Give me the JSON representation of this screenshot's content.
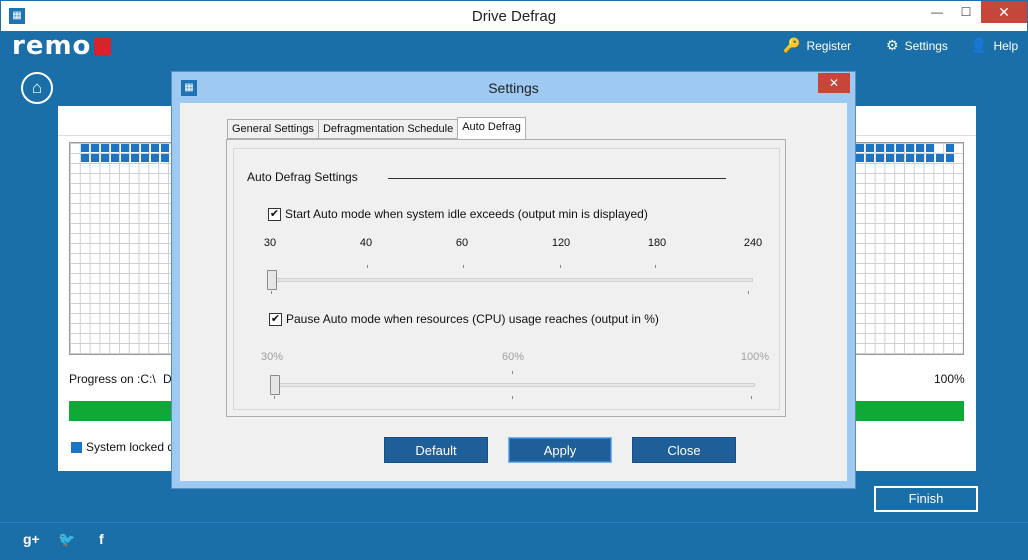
{
  "window": {
    "title": "Drive Defrag",
    "min": "—",
    "max": "☐",
    "close": "✕"
  },
  "brand": {
    "logo_text": "remo"
  },
  "topnav": {
    "register": "Register",
    "settings": "Settings",
    "help": "Help"
  },
  "main": {
    "progress_label": "Progress on :C:\\",
    "progress_label_cut": "D",
    "progress_pct": "100%",
    "legend_label": "System locked da",
    "finish": "Finish",
    "progress_fraction": 1.0
  },
  "social": {
    "gplus": "g+",
    "twitter": "🐦",
    "facebook": "f"
  },
  "dialog": {
    "title": "Settings",
    "close": "✕",
    "tabs": [
      "General Settings",
      "Defragmentation Schedule",
      "Auto Defrag"
    ],
    "active_tab": "Auto Defrag",
    "group_title": "Auto Defrag Settings",
    "idle_check_label": "Start Auto mode when system idle exceeds (output min is displayed)",
    "idle_checked": true,
    "idle_ticks": [
      "30",
      "40",
      "60",
      "120",
      "180",
      "240"
    ],
    "idle_value": "30",
    "cpu_check_label": "Pause Auto mode when resources (CPU) usage reaches (output in %)",
    "cpu_checked": true,
    "cpu_ticks": [
      "30%",
      "60%",
      "100%"
    ],
    "cpu_value": "30%",
    "buttons": {
      "default": "Default",
      "apply": "Apply",
      "close": "Close"
    }
  }
}
